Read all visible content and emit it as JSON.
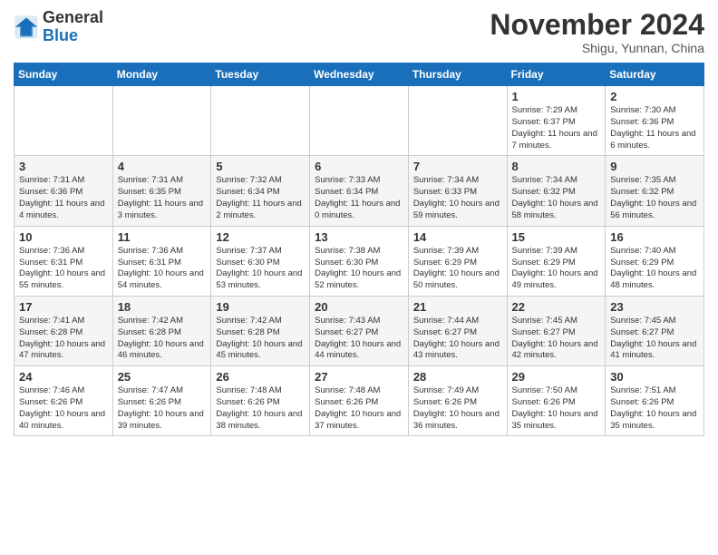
{
  "logo": {
    "general": "General",
    "blue": "Blue"
  },
  "header": {
    "month": "November 2024",
    "location": "Shigu, Yunnan, China"
  },
  "weekdays": [
    "Sunday",
    "Monday",
    "Tuesday",
    "Wednesday",
    "Thursday",
    "Friday",
    "Saturday"
  ],
  "weeks": [
    [
      {
        "day": "",
        "info": ""
      },
      {
        "day": "",
        "info": ""
      },
      {
        "day": "",
        "info": ""
      },
      {
        "day": "",
        "info": ""
      },
      {
        "day": "",
        "info": ""
      },
      {
        "day": "1",
        "info": "Sunrise: 7:29 AM\nSunset: 6:37 PM\nDaylight: 11 hours and 7 minutes."
      },
      {
        "day": "2",
        "info": "Sunrise: 7:30 AM\nSunset: 6:36 PM\nDaylight: 11 hours and 6 minutes."
      }
    ],
    [
      {
        "day": "3",
        "info": "Sunrise: 7:31 AM\nSunset: 6:36 PM\nDaylight: 11 hours and 4 minutes."
      },
      {
        "day": "4",
        "info": "Sunrise: 7:31 AM\nSunset: 6:35 PM\nDaylight: 11 hours and 3 minutes."
      },
      {
        "day": "5",
        "info": "Sunrise: 7:32 AM\nSunset: 6:34 PM\nDaylight: 11 hours and 2 minutes."
      },
      {
        "day": "6",
        "info": "Sunrise: 7:33 AM\nSunset: 6:34 PM\nDaylight: 11 hours and 0 minutes."
      },
      {
        "day": "7",
        "info": "Sunrise: 7:34 AM\nSunset: 6:33 PM\nDaylight: 10 hours and 59 minutes."
      },
      {
        "day": "8",
        "info": "Sunrise: 7:34 AM\nSunset: 6:32 PM\nDaylight: 10 hours and 58 minutes."
      },
      {
        "day": "9",
        "info": "Sunrise: 7:35 AM\nSunset: 6:32 PM\nDaylight: 10 hours and 56 minutes."
      }
    ],
    [
      {
        "day": "10",
        "info": "Sunrise: 7:36 AM\nSunset: 6:31 PM\nDaylight: 10 hours and 55 minutes."
      },
      {
        "day": "11",
        "info": "Sunrise: 7:36 AM\nSunset: 6:31 PM\nDaylight: 10 hours and 54 minutes."
      },
      {
        "day": "12",
        "info": "Sunrise: 7:37 AM\nSunset: 6:30 PM\nDaylight: 10 hours and 53 minutes."
      },
      {
        "day": "13",
        "info": "Sunrise: 7:38 AM\nSunset: 6:30 PM\nDaylight: 10 hours and 52 minutes."
      },
      {
        "day": "14",
        "info": "Sunrise: 7:39 AM\nSunset: 6:29 PM\nDaylight: 10 hours and 50 minutes."
      },
      {
        "day": "15",
        "info": "Sunrise: 7:39 AM\nSunset: 6:29 PM\nDaylight: 10 hours and 49 minutes."
      },
      {
        "day": "16",
        "info": "Sunrise: 7:40 AM\nSunset: 6:29 PM\nDaylight: 10 hours and 48 minutes."
      }
    ],
    [
      {
        "day": "17",
        "info": "Sunrise: 7:41 AM\nSunset: 6:28 PM\nDaylight: 10 hours and 47 minutes."
      },
      {
        "day": "18",
        "info": "Sunrise: 7:42 AM\nSunset: 6:28 PM\nDaylight: 10 hours and 46 minutes."
      },
      {
        "day": "19",
        "info": "Sunrise: 7:42 AM\nSunset: 6:28 PM\nDaylight: 10 hours and 45 minutes."
      },
      {
        "day": "20",
        "info": "Sunrise: 7:43 AM\nSunset: 6:27 PM\nDaylight: 10 hours and 44 minutes."
      },
      {
        "day": "21",
        "info": "Sunrise: 7:44 AM\nSunset: 6:27 PM\nDaylight: 10 hours and 43 minutes."
      },
      {
        "day": "22",
        "info": "Sunrise: 7:45 AM\nSunset: 6:27 PM\nDaylight: 10 hours and 42 minutes."
      },
      {
        "day": "23",
        "info": "Sunrise: 7:45 AM\nSunset: 6:27 PM\nDaylight: 10 hours and 41 minutes."
      }
    ],
    [
      {
        "day": "24",
        "info": "Sunrise: 7:46 AM\nSunset: 6:26 PM\nDaylight: 10 hours and 40 minutes."
      },
      {
        "day": "25",
        "info": "Sunrise: 7:47 AM\nSunset: 6:26 PM\nDaylight: 10 hours and 39 minutes."
      },
      {
        "day": "26",
        "info": "Sunrise: 7:48 AM\nSunset: 6:26 PM\nDaylight: 10 hours and 38 minutes."
      },
      {
        "day": "27",
        "info": "Sunrise: 7:48 AM\nSunset: 6:26 PM\nDaylight: 10 hours and 37 minutes."
      },
      {
        "day": "28",
        "info": "Sunrise: 7:49 AM\nSunset: 6:26 PM\nDaylight: 10 hours and 36 minutes."
      },
      {
        "day": "29",
        "info": "Sunrise: 7:50 AM\nSunset: 6:26 PM\nDaylight: 10 hours and 35 minutes."
      },
      {
        "day": "30",
        "info": "Sunrise: 7:51 AM\nSunset: 6:26 PM\nDaylight: 10 hours and 35 minutes."
      }
    ]
  ]
}
